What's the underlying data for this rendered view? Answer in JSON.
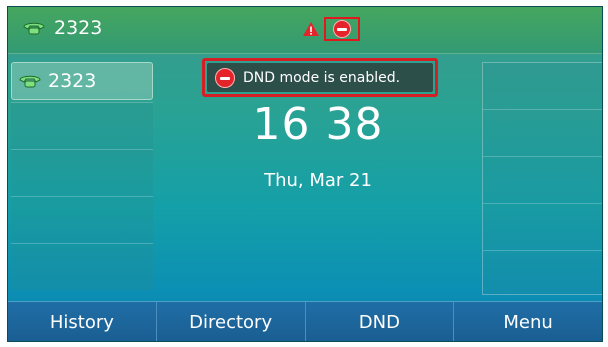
{
  "topbar": {
    "account": "2323",
    "alert_icon": "warning-icon",
    "dnd_icon": "dnd-icon"
  },
  "line_keys": [
    {
      "label": "2323",
      "icon": "phone-icon",
      "active": true
    }
  ],
  "toast": {
    "icon": "dnd-icon",
    "message": "DND mode is enabled."
  },
  "clock": {
    "time": "16 38",
    "date": "Thu, Mar 21"
  },
  "softkeys": [
    "History",
    "Directory",
    "DND",
    "Menu"
  ],
  "colors": {
    "dnd_red": "#e4242a",
    "highlight_red": "#d41f23",
    "softkey_bar": "#1f6ea6"
  }
}
